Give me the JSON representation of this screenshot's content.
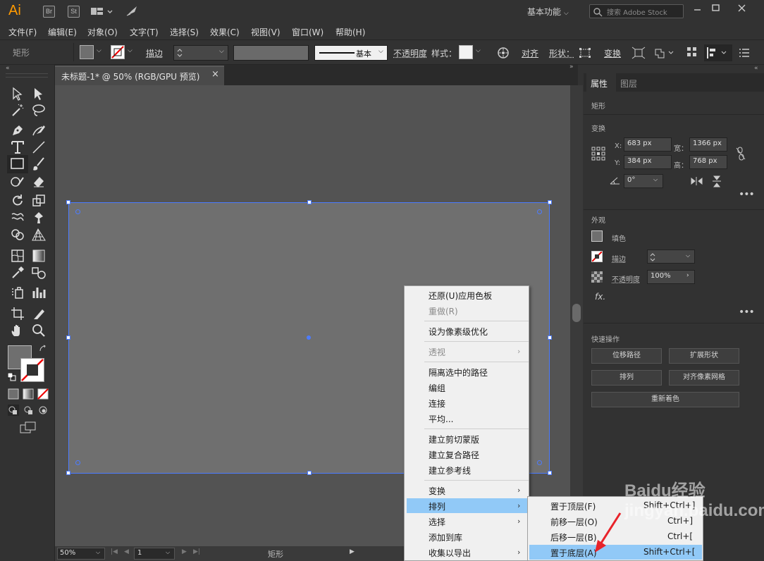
{
  "app": {
    "logo": "Ai",
    "br": "Br",
    "st": "St",
    "workspace": "基本功能",
    "search_placeholder": "搜索 Adobe Stock"
  },
  "menubar": [
    "文件(F)",
    "编辑(E)",
    "对象(O)",
    "文字(T)",
    "选择(S)",
    "效果(C)",
    "视图(V)",
    "窗口(W)",
    "帮助(H)"
  ],
  "control": {
    "object_type": "矩形",
    "stroke_label": "描边",
    "stroke_style": "基本",
    "opacity_label": "不透明度",
    "style_label": "样式：",
    "align": "对齐",
    "shape": "形状：",
    "transform": "变换"
  },
  "document": {
    "tab_title": "未标题-1* @ 50% (RGB/GPU 预览)",
    "zoom": "50%",
    "page": "1",
    "status_text": "矩形"
  },
  "panel": {
    "tabs": [
      "属性",
      "图层"
    ],
    "object_kind": "矩形",
    "transform_title": "变换",
    "x_label": "X:",
    "x": "683 px",
    "y_label": "Y:",
    "y": "384 px",
    "w_label": "宽：",
    "w": "1366 px",
    "h_label": "高：",
    "h": "768 px",
    "angle": "0°",
    "appearance_title": "外观",
    "fill": "填色",
    "stroke": "描边",
    "opacity_label": "不透明度",
    "opacity": "100%",
    "fx": "fx.",
    "quick_title": "快速操作",
    "buttons": [
      "位移路径",
      "扩展形状",
      "排列",
      "对齐像素网格",
      "重新着色"
    ]
  },
  "context_menu": {
    "items": [
      {
        "label": "还原(U)应用色板",
        "disabled": false
      },
      {
        "label": "重做(R)",
        "disabled": true
      },
      {
        "label": "设为像素级优化",
        "disabled": false
      },
      {
        "label": "透视",
        "disabled": true
      },
      {
        "label": "隔离选中的路径",
        "disabled": false
      },
      {
        "label": "编组",
        "disabled": false
      },
      {
        "label": "连接",
        "disabled": false
      },
      {
        "label": "平均...",
        "disabled": false
      },
      {
        "label": "建立剪切蒙版",
        "disabled": false
      },
      {
        "label": "建立复合路径",
        "disabled": false
      },
      {
        "label": "建立参考线",
        "disabled": false
      },
      {
        "label": "变换",
        "disabled": false
      },
      {
        "label": "排列",
        "disabled": false
      },
      {
        "label": "选择",
        "disabled": false
      },
      {
        "label": "添加到库",
        "disabled": false
      },
      {
        "label": "收集以导出",
        "disabled": false
      }
    ]
  },
  "arrange_submenu": {
    "items": [
      {
        "label": "置于顶层(F)",
        "shortcut": "Shift+Ctrl+]"
      },
      {
        "label": "前移一层(O)",
        "shortcut": "Ctrl+]"
      },
      {
        "label": "后移一层(B)",
        "shortcut": "Ctrl+["
      },
      {
        "label": "置于底层(A)",
        "shortcut": "Shift+Ctrl+["
      }
    ]
  },
  "watermark": "Baidu经验 jingyan.baidu.com",
  "colors": {
    "accent": "#4d7cff",
    "logo": "#ff9a00",
    "highlight": "#91c9f7",
    "artboard": "#6f6f6f"
  }
}
